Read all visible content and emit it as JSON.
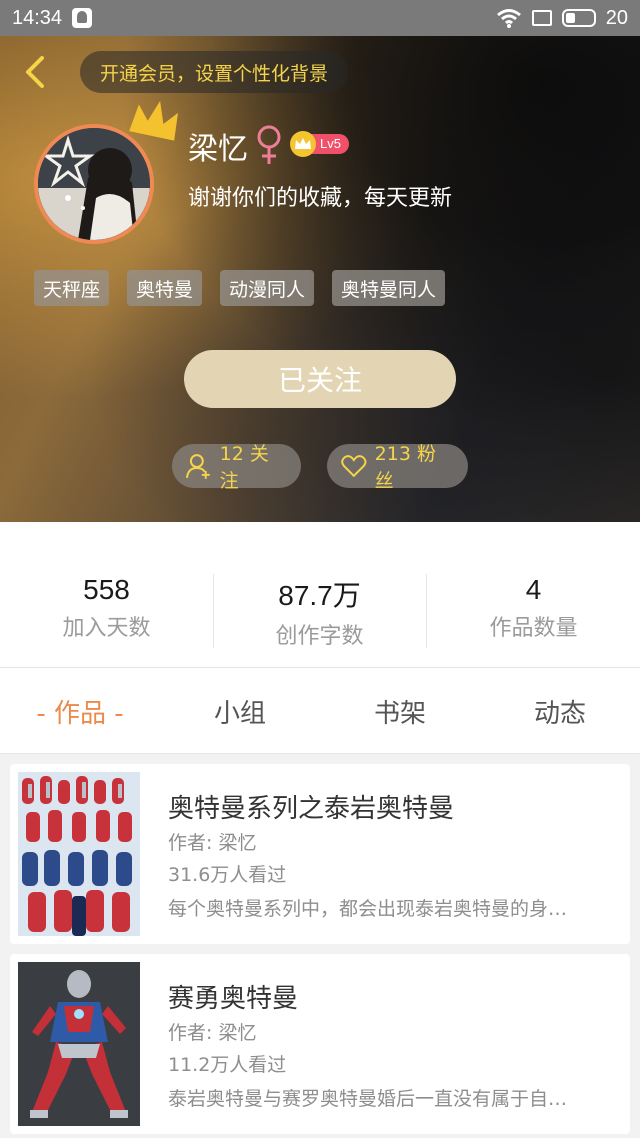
{
  "status_bar": {
    "time": "14:34",
    "battery": "20"
  },
  "header": {
    "vip_banner": "开通会员，设置个性化背景",
    "username": "梁忆",
    "level": "Lv5",
    "signature": "谢谢你们的收藏，每天更新",
    "tags": [
      "天秤座",
      "奥特曼",
      "动漫同人",
      "奥特曼同人"
    ],
    "follow_button": "已关注",
    "following_count": "12 关注",
    "fans_count": "213 粉丝"
  },
  "stats": [
    {
      "value": "558",
      "label": "加入天数"
    },
    {
      "value": "87.7万",
      "label": "创作字数"
    },
    {
      "value": "4",
      "label": "作品数量"
    }
  ],
  "tabs": [
    "- 作品 -",
    "小组",
    "书架",
    "动态"
  ],
  "works": [
    {
      "title": "奥特曼系列之泰岩奥特曼",
      "author": "作者: 梁忆",
      "views": "31.6万人看过",
      "description": "每个奥特曼系列中，都会出现泰岩奥特曼的身…"
    },
    {
      "title": "赛勇奥特曼",
      "author": "作者: 梁忆",
      "views": "11.2万人看过",
      "description": "泰岩奥特曼与赛罗奥特曼婚后一直没有属于自…"
    }
  ],
  "colors": {
    "accent": "#ec8a4c",
    "vip": "#f5d44a",
    "follow_button": "#e3d5b3",
    "avatar_border": "#f08a55",
    "level_badge": "#f0506a"
  }
}
